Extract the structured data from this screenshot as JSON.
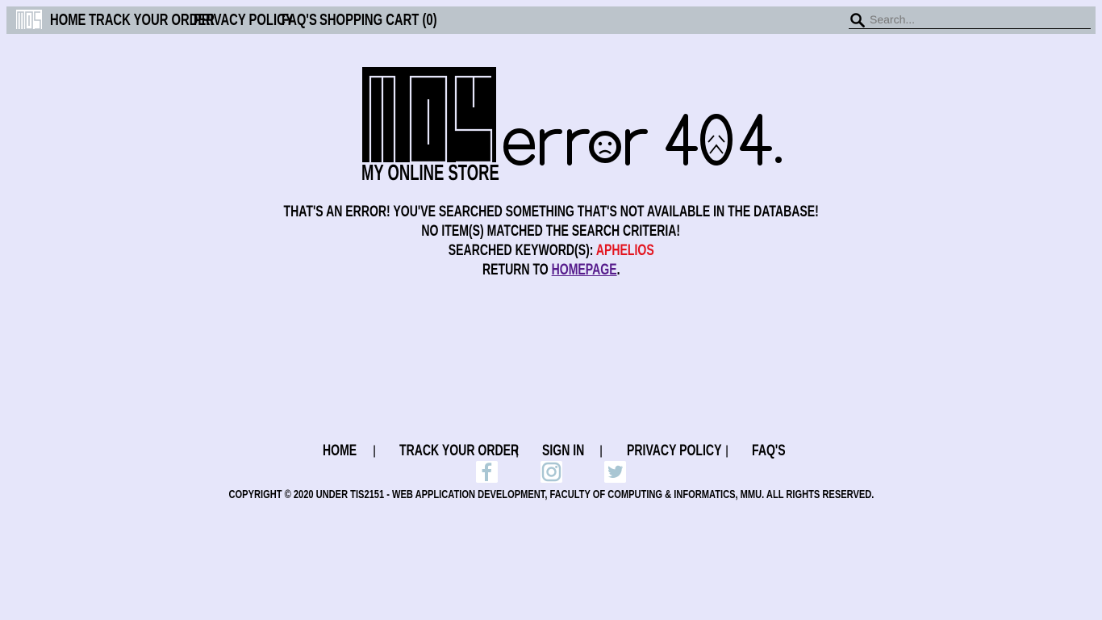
{
  "nav": {
    "logo_text": "MOS",
    "links": [
      "HOME",
      "TRACK YOUR ORDER",
      "PRIVACY POLICY",
      "FAQ'S",
      "SHOPPING CART (0)"
    ],
    "search_placeholder": "Search..."
  },
  "hero": {
    "logo_text": "MOS",
    "tagline": "MY ONLINE STORE",
    "error_title": "error 404."
  },
  "message": {
    "line1": "THAT'S AN ERROR! YOU'VE SEARCHED SOMETHING THAT'S NOT AVAILABLE IN THE DATABASE!",
    "line2": "NO ITEM(S) MATCHED THE SEARCH CRITERIA!",
    "keyword_label": "SEARCHED KEYWORD(S):",
    "keyword_value": "APHELIOS",
    "return_prefix": "RETURN TO",
    "return_link": "HOMEPAGE",
    "return_suffix": "."
  },
  "footer": {
    "links": [
      "HOME",
      "TRACK YOUR ORDER",
      "SIGN IN",
      "PRIVACY POLICY",
      "FAQ'S"
    ],
    "separator": "|",
    "social_icons": [
      "facebook-icon",
      "instagram-icon",
      "twitter-icon"
    ],
    "copyright": "COPYRIGHT © 2020 UNDER TIS2151 - WEB APPLICATION DEVELOPMENT, FACULTY OF COMPUTING & INFORMATICS, MMU. ALL RIGHTS RESERVED."
  },
  "colors": {
    "page_background": "#e6e6fa",
    "navbar_background": "#bcc4cb",
    "keyword": "#e3141e",
    "link": "#551a8b",
    "social_icon": "#a9c6d3"
  }
}
